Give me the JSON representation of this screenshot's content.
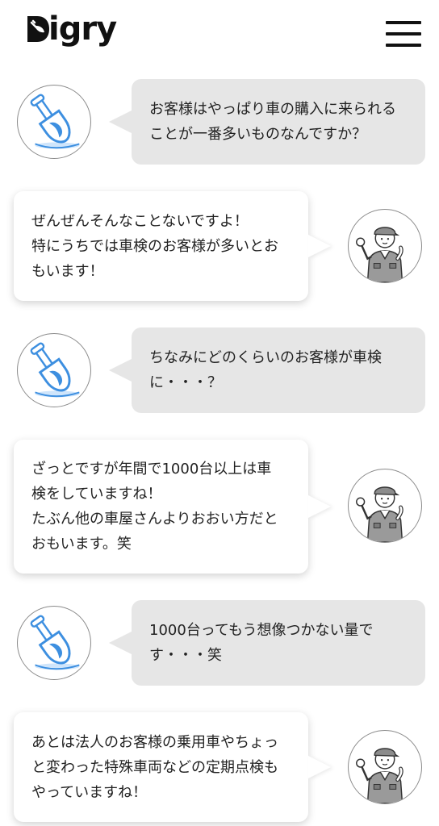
{
  "header": {
    "logo_text": "igry",
    "logo_icon": "shovel-d-logo",
    "menu_icon": "hamburger-menu-icon"
  },
  "colors": {
    "accent_blue": "#3d8fe0",
    "bubble_gray": "#e6e6e6"
  },
  "messages": [
    {
      "speaker": "interviewer",
      "icon": "shovel-avatar",
      "text": "お客様はやっぱり車の購入に来られる\nことが一番多いものなんですか？"
    },
    {
      "speaker": "mechanic",
      "icon": "mechanic-avatar",
      "text": "ぜんぜんそんなことないですよ！\n特にうちでは車検のお客様が多いとお\nもいます！"
    },
    {
      "speaker": "interviewer",
      "icon": "shovel-avatar",
      "text": "ちなみにどのくらいのお客様が車検\nに・・・？"
    },
    {
      "speaker": "mechanic",
      "icon": "mechanic-avatar",
      "text": "ざっとですが年間で1000台以上は車\n検をしていますね！\nたぶん他の車屋さんよりおおい方だと\nおもいます。笑"
    },
    {
      "speaker": "interviewer",
      "icon": "shovel-avatar",
      "text": "1000台ってもう想像つかない量で\nす・・・笑"
    },
    {
      "speaker": "mechanic",
      "icon": "mechanic-avatar",
      "text": "あとは法人のお客様の乗用車やちょっ\nと変わった特殊車両などの定期点検も\nやっていますね！"
    }
  ]
}
